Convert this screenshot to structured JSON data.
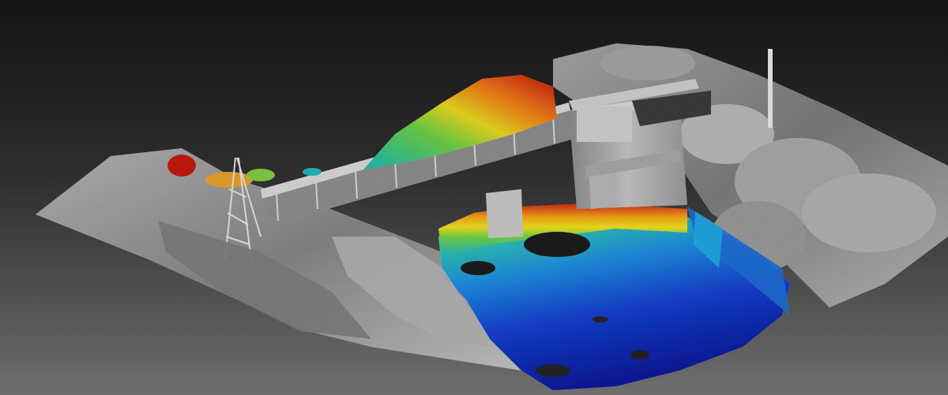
{
  "viewport": {
    "background_top": "#141414",
    "background_bottom": "#6e6e6e",
    "render_style": "3D point cloud (gray-shaded structures, rainbow height-colored water and vegetation)"
  },
  "palette": {
    "structure_gray": "#9c9c9c",
    "structure_light": "#d4d4d4",
    "structure_dark": "#4e4e4e",
    "height_ramp": [
      "#0a1fb0",
      "#1760e0",
      "#1fb3d8",
      "#26c9a0",
      "#8fd83a",
      "#f0e020",
      "#f5a019",
      "#e43515",
      "#b0140f"
    ]
  },
  "scene": {
    "objects": [
      "terrain",
      "canal-basin",
      "lock-gate-structure",
      "footbridge",
      "lattice-mast",
      "pole",
      "hedge",
      "tree-canopy"
    ]
  }
}
